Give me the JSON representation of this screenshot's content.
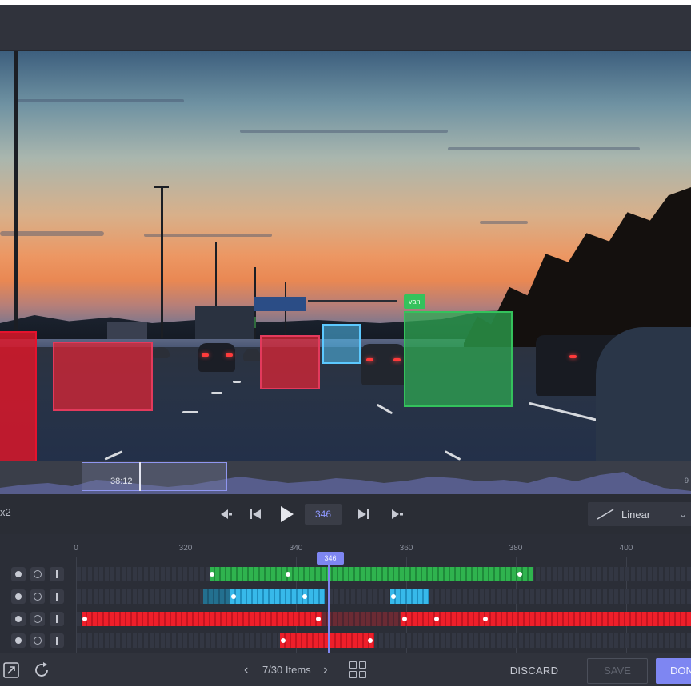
{
  "viewer": {
    "annotation_tag": "van"
  },
  "scrubber": {
    "current_time": "38:12",
    "end_label": "9"
  },
  "controls": {
    "left_label": "x2",
    "current_frame": "346",
    "interpolation": "Linear"
  },
  "timeline": {
    "ruler": [
      "0",
      "320",
      "340",
      "360",
      "380",
      "400"
    ],
    "playhead_label": "346",
    "colors": {
      "green": "#2fb34e",
      "cyan": "#37b9ea",
      "red": "#ee1f2a",
      "accent": "#7e86f2"
    }
  },
  "footer": {
    "pager_prev": "‹",
    "pager_text": "7/30 Items",
    "pager_next": "›",
    "discard_label": "DISCARD",
    "save_label": "SAVE",
    "done_label": "DONE"
  },
  "icons": [
    "skip-back-icon",
    "step-back-icon",
    "play-icon",
    "step-forward-icon",
    "skip-forward-icon",
    "interpolation-icon",
    "dropdown-chevron-icon",
    "expand-icon",
    "refresh-icon",
    "grid-icon",
    "visibility-dot-icon",
    "lock-ring-icon",
    "track-bar-icon"
  ]
}
